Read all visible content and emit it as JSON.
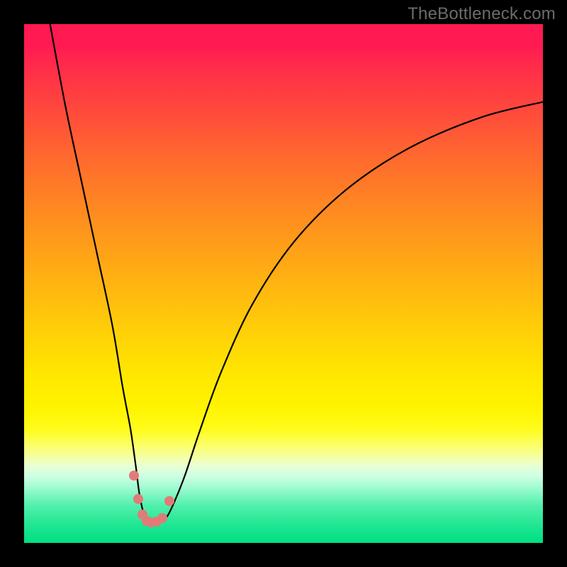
{
  "watermark": "TheBottleneck.com",
  "colors": {
    "frame_bg": "#000000",
    "curve_stroke": "#000000",
    "marker_fill": "#e17b78"
  },
  "chart_data": {
    "type": "line",
    "title": "",
    "xlabel": "",
    "ylabel": "",
    "xlim": [
      0,
      100
    ],
    "ylim": [
      0,
      100
    ],
    "series": [
      {
        "name": "bottleneck-curve",
        "x": [
          5,
          8,
          11,
          14,
          17,
          19,
          20.5,
          21.5,
          22.3,
          23.3,
          24.6,
          26,
          27.5,
          29,
          31,
          34,
          38,
          44,
          52,
          62,
          74,
          88,
          100
        ],
        "y": [
          100,
          84,
          70,
          56,
          42,
          30,
          22,
          15,
          9,
          5,
          4,
          4,
          5,
          8,
          13,
          22,
          33,
          46,
          58,
          68,
          76,
          82,
          85
        ]
      }
    ],
    "markers": {
      "name": "highlight-dots",
      "x": [
        21.2,
        22.0,
        22.8,
        23.6,
        24.5,
        25.5,
        26.6,
        28.0
      ],
      "y": [
        13.0,
        8.5,
        5.5,
        4.2,
        4.0,
        4.1,
        4.8,
        8.0
      ]
    }
  }
}
